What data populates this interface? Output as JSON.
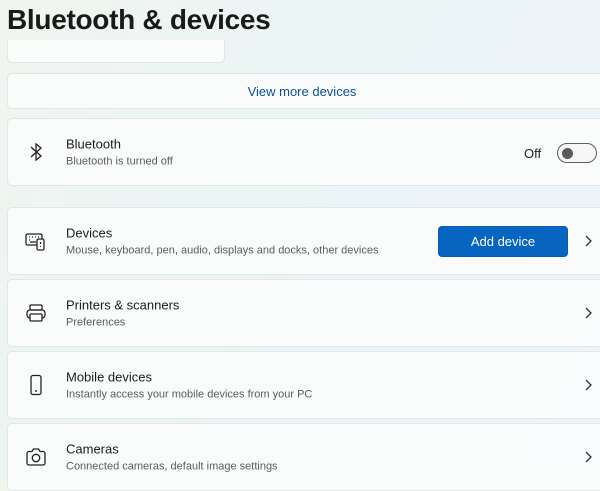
{
  "header": {
    "title": "Bluetooth & devices"
  },
  "view_more": "View more devices",
  "bluetooth": {
    "title": "Bluetooth",
    "subtitle": "Bluetooth is turned off",
    "state_label": "Off",
    "enabled": false
  },
  "rows": [
    {
      "title": "Devices",
      "subtitle": "Mouse, keyboard, pen, audio, displays and docks, other devices",
      "button": "Add device",
      "icon": "keyboard-mouse-icon"
    },
    {
      "title": "Printers & scanners",
      "subtitle": "Preferences",
      "icon": "printer-icon"
    },
    {
      "title": "Mobile devices",
      "subtitle": "Instantly access your mobile devices from your PC",
      "icon": "phone-icon"
    },
    {
      "title": "Cameras",
      "subtitle": "Connected cameras, default image settings",
      "icon": "camera-icon"
    }
  ],
  "colors": {
    "accent": "#0765c2",
    "link": "#0b4f9c"
  }
}
